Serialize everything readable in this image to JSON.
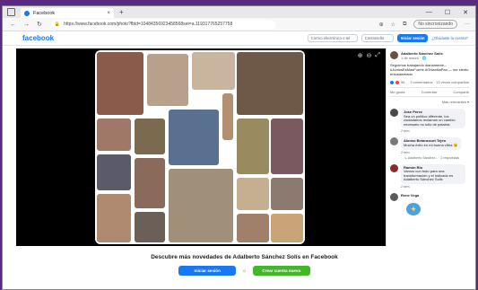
{
  "browser": {
    "tab_title": "Facebook",
    "tab_close": "×",
    "new_tab": "+",
    "window_controls": [
      "—",
      "☐",
      "✕"
    ],
    "url": "https://www.facebook.com/photo?fbid=10484356923458568set=a.119317765257758",
    "sync_label": "No sincronizando",
    "more": "···"
  },
  "facebook_header": {
    "logo": "facebook",
    "email_placeholder": "Correo electrónico o tel",
    "password_placeholder": "Contraseña",
    "login_label": "Iniciar sesión",
    "forgot_label": "¿Olvidaste la cuenta?"
  },
  "post": {
    "author": "Adalberto Sánchez Solís",
    "time": "1 de marzo · 🌐",
    "text": "Seguimos trabajando diariamente... #JuntosEsMásFuerte #OhlaxitlaPan — me siento entusiasmado.",
    "reactions_count": "56",
    "stats": "9 comentarios · 13 veces compartido",
    "like_label": "Me gusta",
    "comment_label": "Comentar",
    "share_label": "Compartir",
    "relevance_label": "Más relevantes ▾"
  },
  "comments": [
    {
      "name": "Jose Perez",
      "text": "Sea un político diferente, los ciudadanos reclaman un cambio necesario no sólo de palabra.",
      "meta": "2 sem"
    },
    {
      "name": "Alonso Betancourt Tejeo",
      "text": "Mucha éxito en mi buena vibra 😉",
      "meta": "2 sem"
    },
    {
      "name": "Ramón Rio",
      "text": "Vamos con todo para una transformación y el indicado es Adalberto Sánchez Solis",
      "meta": "2 sem"
    },
    {
      "name": "Rene Vega",
      "text": "",
      "meta": ""
    }
  ],
  "reply_label": "↳ Adalberto Sánchez... · 2 respuestas",
  "banner": {
    "title": "Descubre más novedades de Adalberto Sánchez Solís en Facebook",
    "login_label": "Iniciar sesión",
    "or_label": "o",
    "create_label": "Crear cuenta nueva"
  },
  "colors": {
    "brand": "#1877f2",
    "create": "#42b72a"
  }
}
